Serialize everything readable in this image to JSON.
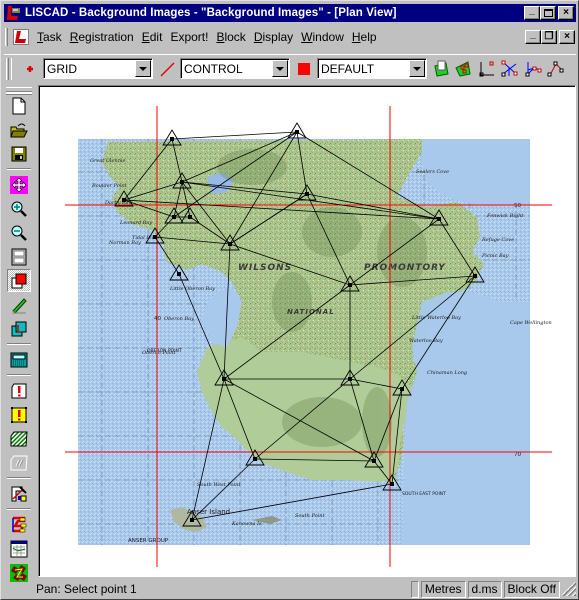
{
  "window": {
    "title": "LISCAD - Background Images - \"Background Images\" - [Plan View]",
    "controls": {
      "minimize": "_",
      "maximize": "□",
      "close": "×"
    }
  },
  "menubar": {
    "items": [
      {
        "label": "Task",
        "accel": "T",
        "rest": "ask"
      },
      {
        "label": "Registration",
        "accel": "R",
        "rest": "egistration"
      },
      {
        "label": "Edit",
        "accel": "E",
        "rest": "dit"
      },
      {
        "label": "Export!",
        "accel": "",
        "rest": "Export!"
      },
      {
        "label": "Block",
        "accel": "B",
        "rest": "lock"
      },
      {
        "label": "Display",
        "accel": "D",
        "rest": "isplay"
      },
      {
        "label": "Window",
        "accel": "W",
        "rest": "indow"
      },
      {
        "label": "Help",
        "accel": "H",
        "rest": "elp"
      }
    ],
    "doc_controls": {
      "minimize": "_",
      "restore": "❐",
      "close": "×"
    }
  },
  "toolbar": {
    "point_layer": {
      "icon": "point-style-icon",
      "value": "GRID"
    },
    "line_layer": {
      "icon": "line-style-icon",
      "value": "CONTROL"
    },
    "color_layer": {
      "icon": "color-swatch-icon",
      "color": "#ff0000",
      "value": "DEFAULT"
    },
    "tools": [
      "background-image-icon",
      "image-registration-icon",
      "rectangle-points-icon",
      "intersection-icon",
      "resection-icon",
      "traverse-line-icon"
    ]
  },
  "left_toolbar": {
    "tools": [
      {
        "name": "new-file-icon"
      },
      {
        "name": "open-folder-icon"
      },
      {
        "name": "save-disk-icon"
      },
      {
        "name": "pan-icon",
        "active": true
      },
      {
        "name": "zoom-in-icon"
      },
      {
        "name": "zoom-out-icon"
      },
      {
        "name": "zoom-window-icon"
      },
      {
        "name": "layer-color-icon",
        "pressed": true
      },
      {
        "name": "pencil-edit-icon"
      },
      {
        "name": "copy-move-icon"
      },
      {
        "name": "calculator-icon"
      },
      {
        "name": "warning-white-icon"
      },
      {
        "name": "warning-yellow-icon"
      },
      {
        "name": "hatch-area-icon"
      },
      {
        "name": "disabled-tool-icon"
      },
      {
        "name": "measure-tool-icon"
      },
      {
        "name": "coordinate-list-icon"
      },
      {
        "name": "report-table-icon"
      },
      {
        "name": "network-icon"
      }
    ]
  },
  "map": {
    "big_labels": [
      "WILSONS",
      "PROMONTORY",
      "NATIONAL"
    ],
    "place_labels": [
      "Sealers Cove",
      "Refuge Cove",
      "Waterloo Bay",
      "Little Waterloo Bay",
      "Oberon Bay",
      "Norman Bay",
      "Tidal River",
      "Little Oberon Bay",
      "South West Point",
      "Anser Island",
      "Kanowna Is",
      "South Point",
      "Great Glennie",
      "Cape Wellington",
      "Boulder Point",
      "Oberon Point",
      "Darby Bay",
      "Fenwick Bight",
      "Chinaman Long",
      "Leonard Bay",
      "Picnic Bay"
    ],
    "caps_labels": [
      "ANSER GROUP",
      "SOUTH EAST POINT",
      "OBERON POINT"
    ],
    "grid_labels": [
      "40",
      "50",
      "70"
    ]
  },
  "statusbar": {
    "message": "Pan: Select point 1",
    "units": "Metres",
    "angle": "d.ms",
    "block": "Block Off"
  }
}
